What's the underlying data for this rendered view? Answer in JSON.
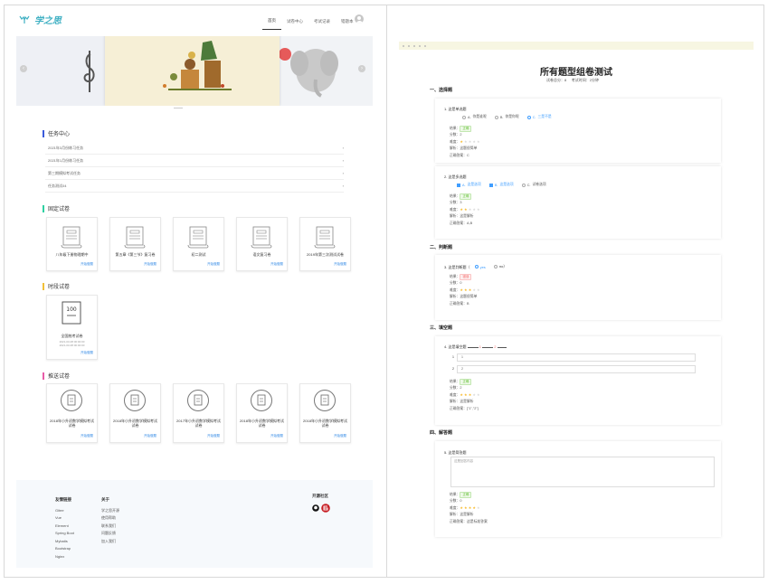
{
  "left": {
    "logo_text": "学之思",
    "nav": [
      "首页",
      "试卷中心",
      "考试记录",
      "错题本"
    ],
    "task_center": {
      "title": "任务中心",
      "items": [
        "2021年3月份练习任务",
        "2021年1月份练习任务",
        "第三期模拟考试任务",
        "任务测试04"
      ]
    },
    "fixed_papers": {
      "title": "固定试卷",
      "cards": [
        {
          "name": "八年级下册物理期中",
          "action": "开始做题"
        },
        {
          "name": "第五章《第三节》复习卷",
          "action": "开始做题"
        },
        {
          "name": "初二测试",
          "action": "开始做题"
        },
        {
          "name": "语文复习卷",
          "action": "开始做题"
        },
        {
          "name": "2019年第三次测试试卷",
          "action": "开始做题"
        }
      ]
    },
    "timed_papers": {
      "title": "时段试卷",
      "cards": [
        {
          "name": "全国统考试卷",
          "time1": "2021-03-08 00:00:00",
          "time2": "2021-03-08 00:00:00",
          "action": "开始做题"
        }
      ]
    },
    "push_papers": {
      "title": "推送试卷",
      "cards": [
        {
          "name": "2018年小升初数学模拟考试试卷",
          "action": "开始做题"
        },
        {
          "name": "2018年小升初数学模拟考试试卷",
          "action": "开始做题"
        },
        {
          "name": "2017年小升初数学模拟考试试卷",
          "action": "开始做题"
        },
        {
          "name": "2018年小升初数学模拟考试试卷",
          "action": "开始做题"
        },
        {
          "name": "2018年小升初数学模拟考试试卷",
          "action": "开始做题"
        }
      ]
    },
    "footer": {
      "col1": {
        "title": "友情链接",
        "items": [
          "Gitee",
          "Vue",
          "Element",
          "Spring Boot",
          "Mybatis",
          "Bootstrap",
          "Nginx"
        ]
      },
      "col2": {
        "title": "关于",
        "items": [
          "学之思开源",
          "使用帮助",
          "联系我们",
          "问题反馈",
          "加入我们"
        ]
      },
      "open_title": "开源社区"
    }
  },
  "right": {
    "title": "所有题型组卷测试",
    "meta": {
      "score_label": "试卷总分：",
      "score": "8",
      "time_label": "考试时间：",
      "time": "2分钟"
    },
    "sections": [
      "一、选择题",
      "二、判断题",
      "三、填空题",
      "四、解答题"
    ],
    "q1": {
      "title": "1. 这是单选题",
      "options": [
        {
          "key": "A.",
          "text": "你是谁呢"
        },
        {
          "key": "B.",
          "text": "你是你呢"
        },
        {
          "key": "C.",
          "text": "三是不是"
        }
      ],
      "result_label": "结果：",
      "result": "正确",
      "score_label": "分数：",
      "score": "2",
      "difficulty_label": "难度：",
      "parse_label": "解析：",
      "parse": "这题很简单",
      "answer_label": "正确答案：",
      "answer": "C"
    },
    "q2": {
      "title": "2. 这是多选题",
      "options": [
        {
          "key": "A.",
          "text": "这是选项"
        },
        {
          "key": "B.",
          "text": "这是选项"
        },
        {
          "key": "C.",
          "text": "试卷选项"
        }
      ],
      "result_label": "结果：",
      "result": "正确",
      "score_label": "分数：",
      "score": "3",
      "difficulty_label": "难度：",
      "parse_label": "解析：",
      "parse": "这是解析",
      "answer_label": "正确答案：",
      "answer": "A,B"
    },
    "q3": {
      "title": "3. 这是判断题（",
      "opt_true": "yes",
      "opt_false": "no）",
      "result_label": "结果：",
      "result": "错误",
      "score_label": "分数：",
      "score": "0",
      "difficulty_label": "难度：",
      "parse_label": "解析：",
      "parse": "这题很简单",
      "answer_label": "正确答案：",
      "answer": "B"
    },
    "q4": {
      "title": "4. 这是填空题",
      "blanks": [
        "1",
        "2"
      ],
      "result_label": "结果：",
      "result": "正确",
      "score_label": "分数：",
      "score": "2",
      "difficulty_label": "难度：",
      "parse_label": "解析：",
      "parse": "这是解析",
      "answer_label": "正确答案：",
      "answer": "[\"1\",\"2\"]"
    },
    "q5": {
      "title": "5. 这是简答题",
      "response": "这是回答内容",
      "result_label": "结果：",
      "result": "正确",
      "score_label": "分数：",
      "score": "0",
      "difficulty_label": "难度：",
      "parse_label": "解析：",
      "parse": "这是解析",
      "answer_label": "正确答案：",
      "answer": "这是标准答案"
    }
  },
  "colors": {
    "accent": "#409eff",
    "success": "#67c23a",
    "danger": "#f56c6c",
    "star": "#f7ba2a"
  }
}
